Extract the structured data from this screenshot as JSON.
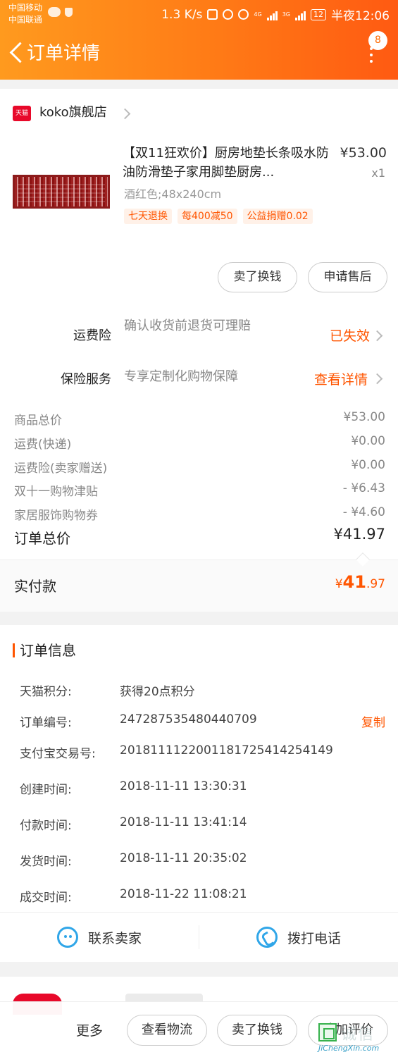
{
  "status_bar": {
    "carrier1": "中国移动",
    "carrier2": "中国联通",
    "speed": "1.3 K/s",
    "network1": "4G",
    "network2": "3G",
    "battery": "12",
    "time": "半夜12:06"
  },
  "header": {
    "title": "订单详情",
    "badge_count": "8"
  },
  "store": {
    "badge": "天猫",
    "name": "koko旗舰店"
  },
  "product": {
    "title": "【双11狂欢价】厨房地垫长条吸水防油防滑垫子家用脚垫厨房...",
    "price": "¥53.00",
    "qty": "x1",
    "spec": "酒红色;48x240cm",
    "tags": [
      "七天退换",
      "每400减50",
      "公益捐赠0.02"
    ]
  },
  "item_actions": {
    "sell": "卖了换钱",
    "after_sale": "申请售后"
  },
  "shipping_insurance": {
    "label": "运费险",
    "desc": "确认收货前退货可理赔",
    "status": "已失效"
  },
  "insurance_service": {
    "label": "保险服务",
    "desc": "专享定制化购物保障",
    "link": "查看详情"
  },
  "summary": {
    "rows": [
      {
        "label": "商品总价",
        "value": "¥53.00"
      },
      {
        "label": "运费(快递)",
        "value": "¥0.00"
      },
      {
        "label": "运费险(卖家赠送)",
        "value": "¥0.00"
      },
      {
        "label": "双十一购物津贴",
        "value": "- ¥6.43"
      },
      {
        "label": "家居服饰购物券",
        "value": "- ¥4.60"
      }
    ],
    "total_label": "订单总价",
    "total_value": "¥41.97",
    "paid_label": "实付款",
    "paid_symbol": "¥",
    "paid_int": "41",
    "paid_dec": ".97"
  },
  "order_info": {
    "title": "订单信息",
    "rows": [
      {
        "label": "天猫积分:",
        "value": "获得20点积分"
      },
      {
        "label": "订单编号:",
        "value": "247287535480440709"
      },
      {
        "label": "支付宝交易号:",
        "value": "2018111122001181725414254149"
      },
      {
        "label": "创建时间:",
        "value": "2018-11-11 13:30:31"
      },
      {
        "label": "付款时间:",
        "value": "2018-11-11 13:41:14"
      },
      {
        "label": "发货时间:",
        "value": "2018-11-11 20:35:02"
      },
      {
        "label": "成交时间:",
        "value": "2018-11-22 11:08:21"
      }
    ],
    "copy_label": "复制"
  },
  "contact": {
    "seller": "联系卖家",
    "call": "拨打电话"
  },
  "bottom_bar": {
    "more": "更多",
    "logistics": "查看物流",
    "sell": "卖了换钱",
    "review": "追加评价"
  },
  "watermark": {
    "text": "诚信",
    "url": "JiChengXin.com"
  }
}
